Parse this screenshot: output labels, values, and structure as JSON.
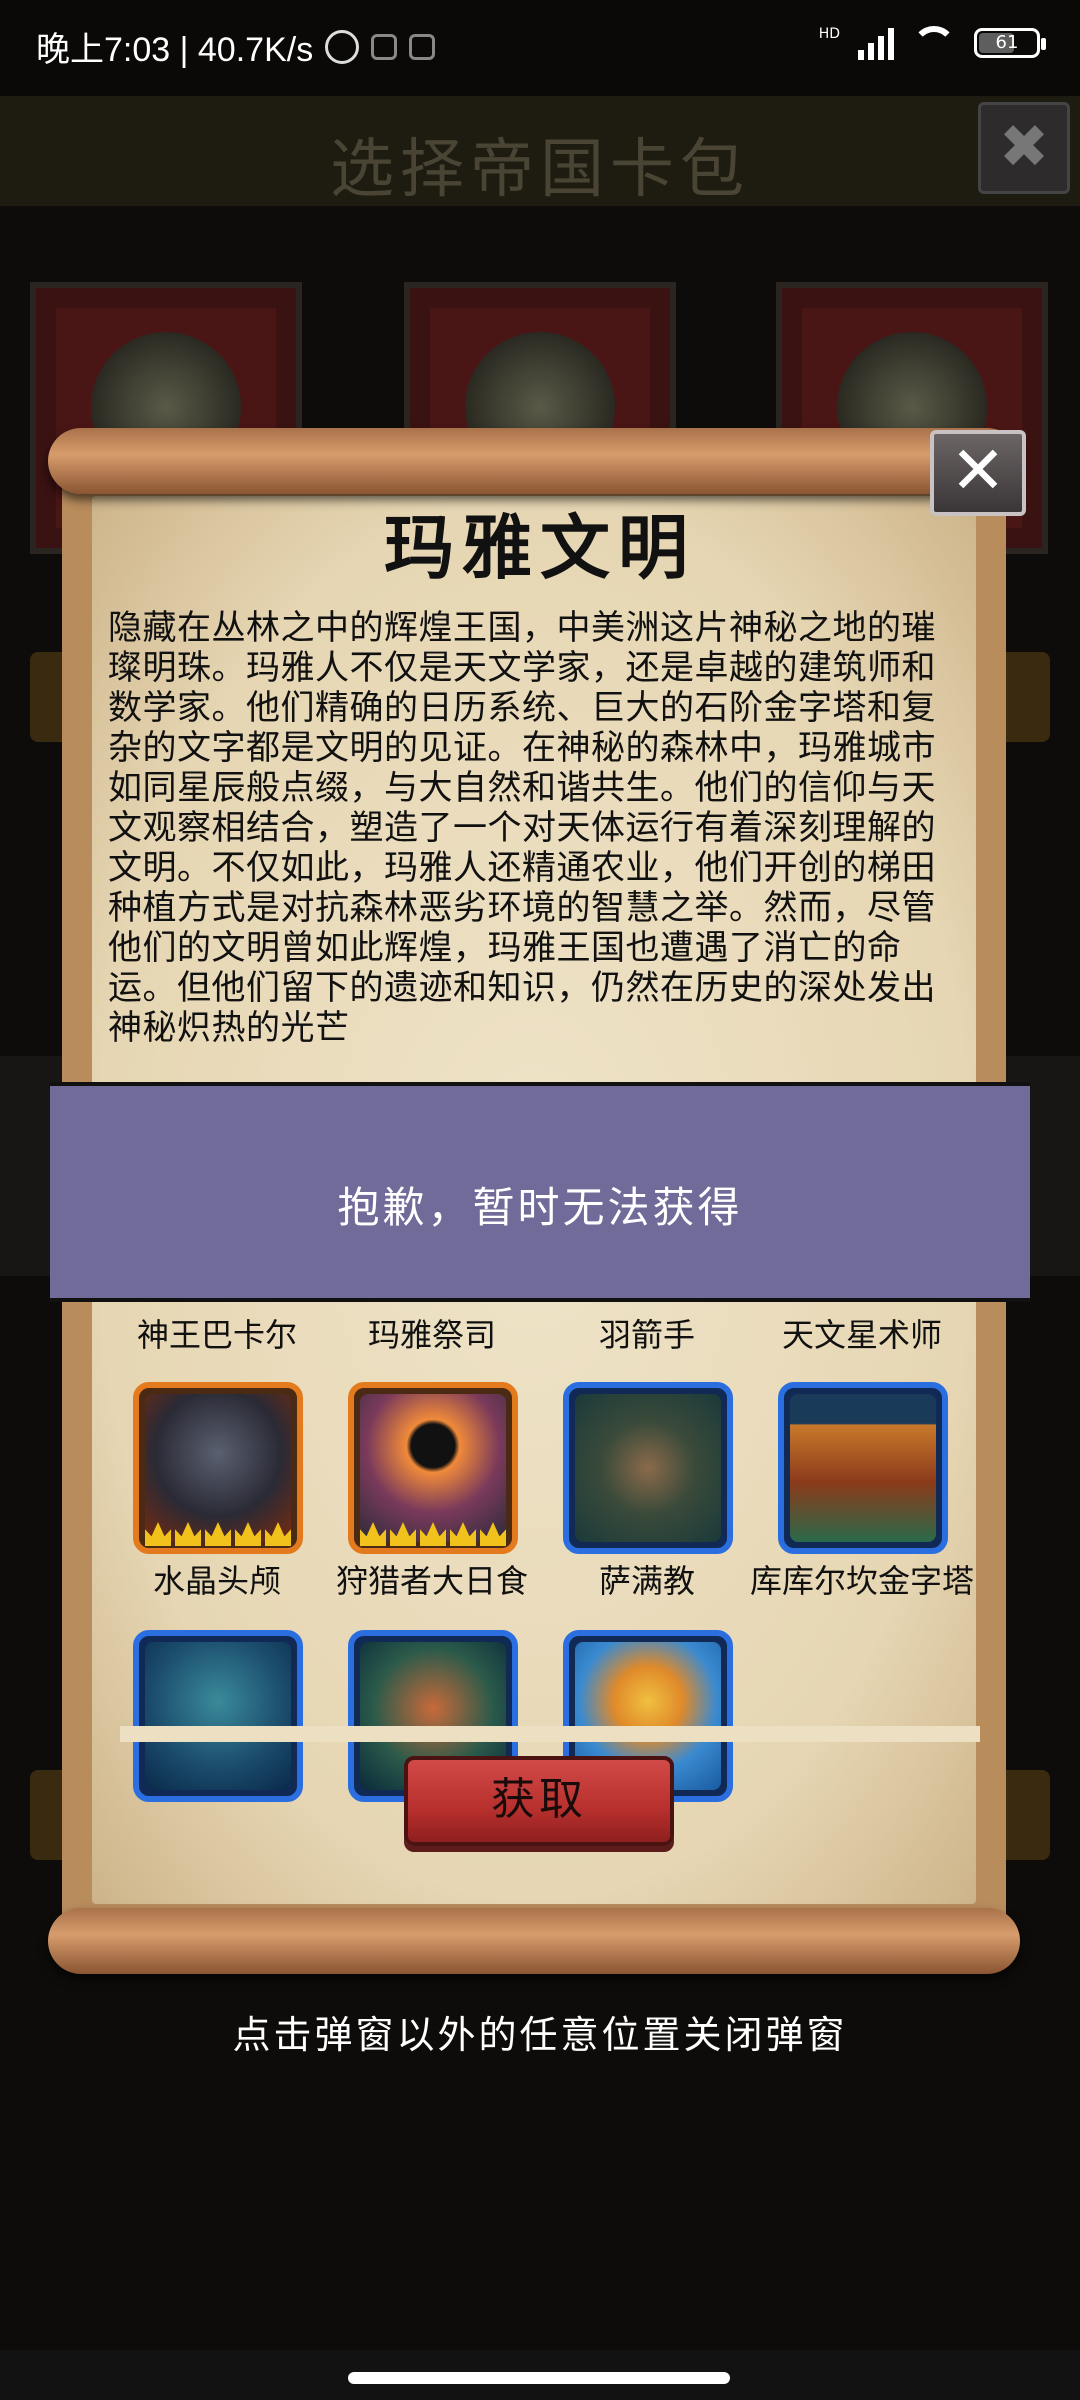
{
  "status_bar": {
    "time": "晚上7:03 | 40.7K/s",
    "network": "HD",
    "battery": "61"
  },
  "background_screen": {
    "title": "选择帝国卡包"
  },
  "modal": {
    "title": "玛雅文明",
    "description": "隐藏在丛林之中的辉煌王国，中美洲这片神秘之地的璀璨明珠。玛雅人不仅是天文学家，还是卓越的建筑师和数学家。他们精确的日历系统、巨大的石阶金字塔和复杂的文字都是文明的见证。在神秘的森林中，玛雅城市如同星辰般点缀，与大自然和谐共生。他们的信仰与天文观察相结合，塑造了一个对天体运行有着深刻理解的文明。不仅如此，玛雅人还精通农业，他们开创的梯田种植方式是对抗森林恶劣环境的智慧之举。然而，尽管他们的文明曾如此辉煌，玛雅王国也遭遇了消亡的命运。但他们留下的遗迹和知识，仍然在历史的深处发出神秘炽热的光芒",
    "toast": "抱歉，暂时无法获得",
    "labels_row1": [
      "神王巴卡尔",
      "玛雅祭司",
      "羽箭手",
      "天文星术师"
    ],
    "cards_row2": [
      {
        "label": "水晶头颅",
        "rarity": "orange",
        "icon": "skull-icon"
      },
      {
        "label": "狩猎者大日食",
        "rarity": "orange",
        "icon": "eclipse-hunter-icon"
      },
      {
        "label": "萨满教",
        "rarity": "blue",
        "icon": "shaman-mask-icon"
      },
      {
        "label": "库库尔坎金字塔",
        "rarity": "blue",
        "icon": "pyramid-icon"
      }
    ],
    "cards_row3": [
      {
        "rarity": "blue",
        "icon": "feathered-serpent-icon"
      },
      {
        "rarity": "blue",
        "icon": "mask-icon"
      },
      {
        "rarity": "blue",
        "icon": "sun-warrior-icon"
      }
    ],
    "get_button": "获取",
    "close_icon": "close-icon"
  },
  "hint": "点击弹窗以外的任意位置关闭弹窗",
  "colors": {
    "toast_bg": "#716b9a",
    "button_red": "#b8302e",
    "rarity_orange": "#e47a1e",
    "rarity_blue": "#2b6ee0"
  }
}
